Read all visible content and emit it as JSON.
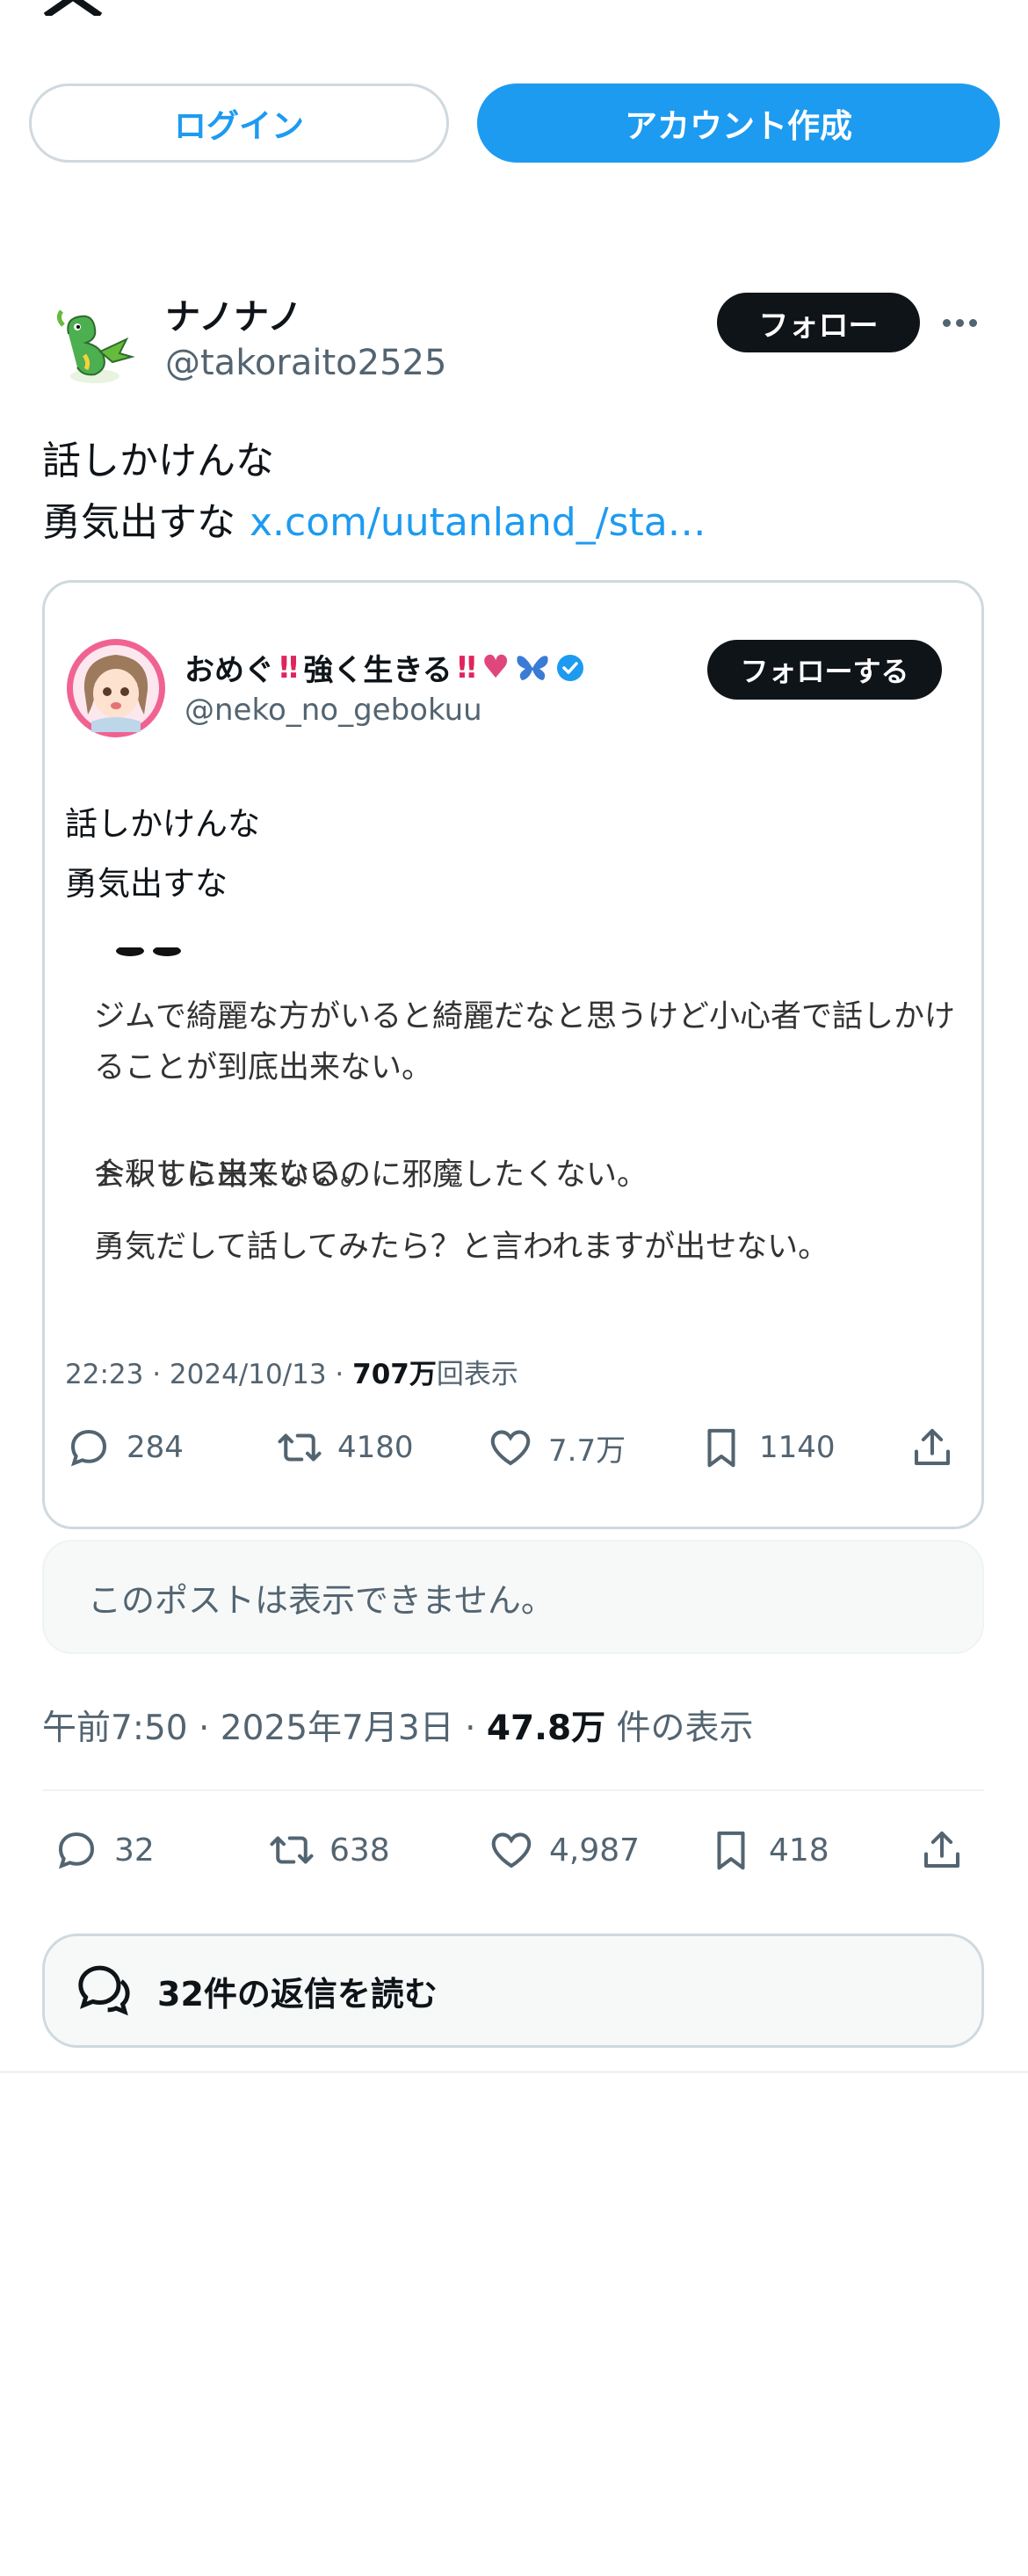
{
  "auth": {
    "login_label": "ログイン",
    "signup_label": "アカウント作成"
  },
  "post": {
    "author_name": "ナノナノ",
    "author_handle": "@takoraito2525",
    "follow_label": "フォロー",
    "text_line1": "話しかけんな",
    "text_line2": "勇気出すな",
    "link_text": "x.com/uutanland_/sta…",
    "time": "午前7:50",
    "date": "2025年7月3日",
    "views_count": "47.8万",
    "views_label": "件の表示",
    "replies": "32",
    "reposts": "638",
    "likes": "4,987",
    "bookmarks": "418",
    "read_replies_label": "32件の返信を読む",
    "unavailable_text": "このポストは表示できません。"
  },
  "embedded": {
    "name_part1": "おめぐ",
    "name_part2": "強く生きる",
    "handle": "@neko_no_gebokuu",
    "follow_label": "フォローする",
    "text_line1": "話しかけんな",
    "text_line2": "勇気出すな",
    "quoted_line1": "ジムで綺麗な方がいると綺麗だなと思うけど小心者で話しかけることが到底出来ない。",
    "quoted_line2": "会釈すら出来ない。",
    "quoted_line3": "トレしに来ているのに邪魔したくない。",
    "quoted_line4": "勇気だして話してみたら？と言われますが出せない。",
    "time_date": "22:23 · 2024/10/13 · ",
    "views_count": "707万",
    "views_label": "回表示",
    "replies": "284",
    "reposts": "4180",
    "likes": "7.7万",
    "bookmarks": "1140"
  },
  "colors": {
    "accent": "#1d9bf0",
    "text": "#0f1419",
    "secondary": "#536471",
    "border": "#cfd9de"
  }
}
